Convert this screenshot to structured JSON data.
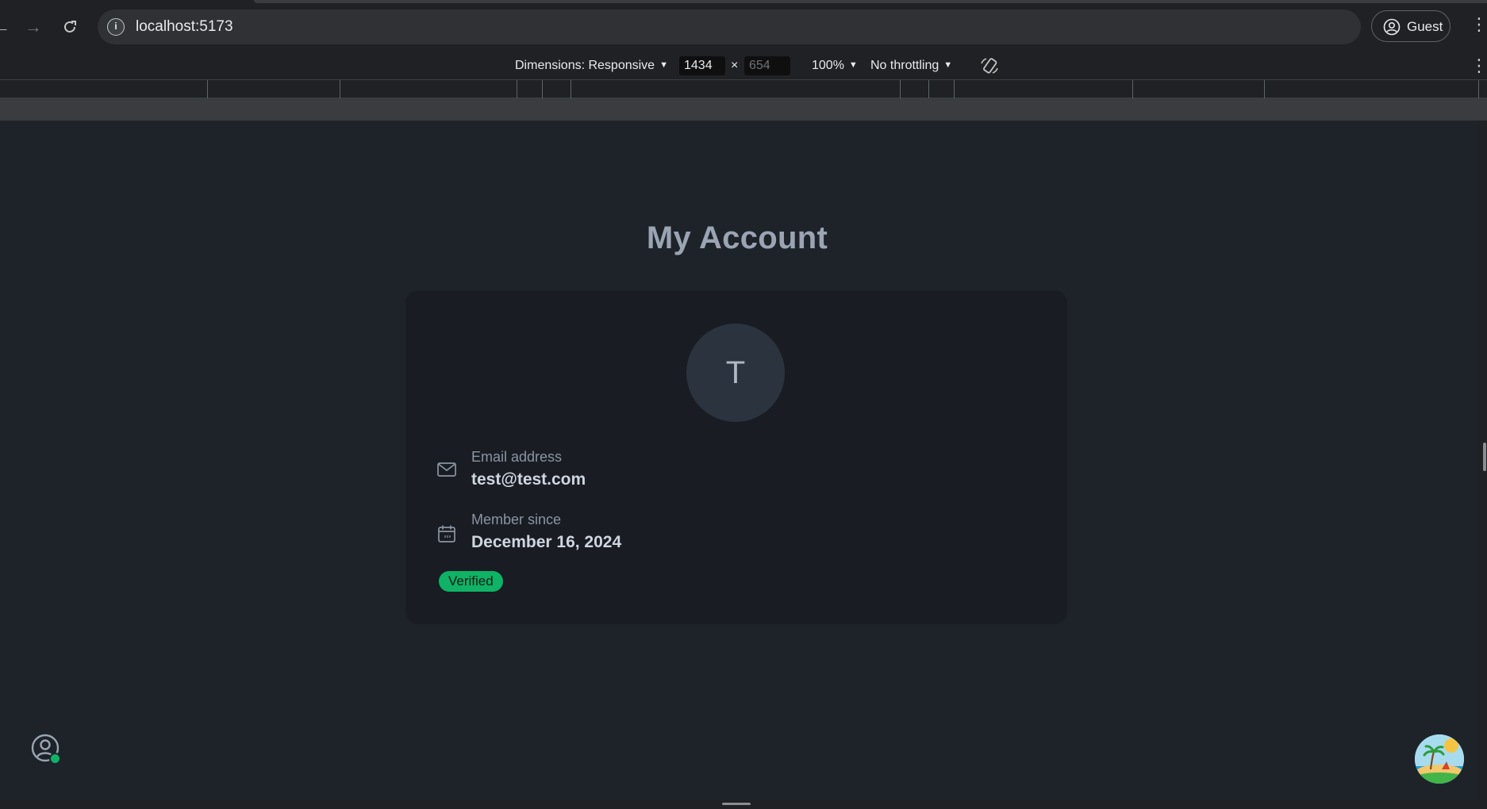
{
  "browser": {
    "url": "localhost:5173",
    "profile_label": "Guest"
  },
  "devtools": {
    "dimensions_label": "Dimensions: Responsive",
    "width_value": "1434",
    "height_value": "654",
    "times_sign": "×",
    "zoom_label": "100%",
    "throttling_label": "No throttling"
  },
  "page": {
    "title": "My Account",
    "avatar_initial": "T",
    "email": {
      "label": "Email address",
      "value": "test@test.com"
    },
    "member_since": {
      "label": "Member since",
      "value": "December 16, 2024"
    },
    "status_badge": "Verified",
    "colors": {
      "background": "#1e232a",
      "card": "#191d23",
      "badge": "#10b265",
      "title": "#9aa4b2"
    }
  },
  "icons": [
    "back-arrow-icon",
    "forward-arrow-icon",
    "reload-icon",
    "info-icon",
    "account-circle-icon",
    "more-vertical-icon",
    "rotate-icon",
    "mail-icon",
    "calendar-icon",
    "user-circle-icon",
    "island-avatar-icon"
  ]
}
